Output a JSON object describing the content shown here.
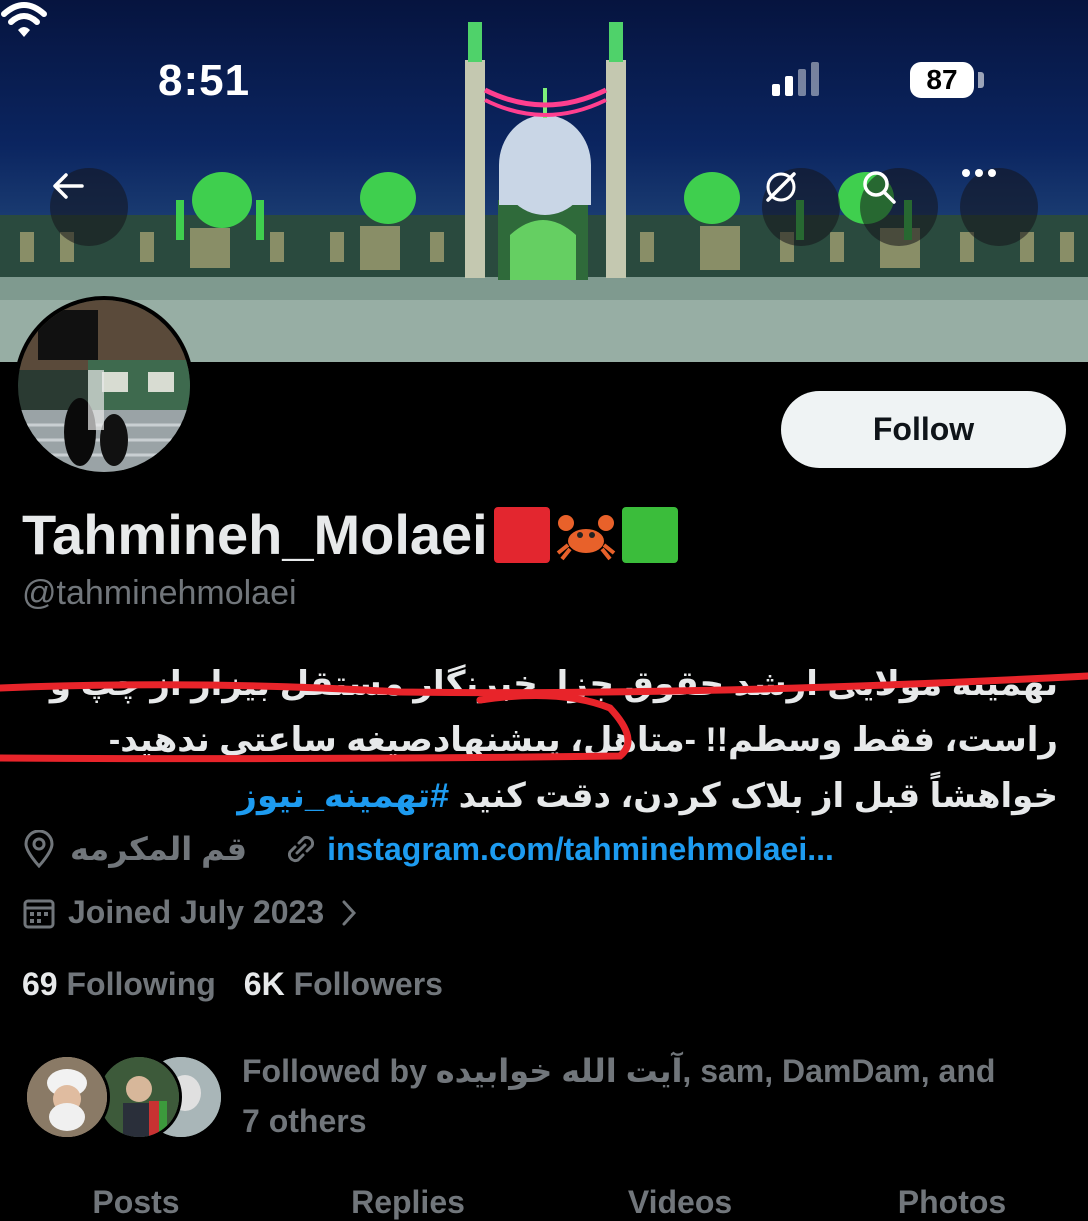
{
  "status_bar": {
    "time": "8:51",
    "battery": "87"
  },
  "profile": {
    "display_name": "Tahmineh_Molaei",
    "name_emojis": [
      "red-square",
      "crab",
      "green-square"
    ],
    "handle": "@tahminehmolaei",
    "follow_label": "Follow",
    "bio_line1": "تهمینه مولایی ارشد حقوق جزا. خبرنگار مستقل بیزار از چپ و",
    "bio_line2": "راست، فقط وسطم!! -متاهل، پیشنهادصیغه ساعتی ندهید-",
    "bio_line3": "خواهشاً قبل از بلاک کردن، دقت کنید",
    "bio_hashtag": "#تهمینه_نیوز",
    "location": "قم المکرمه",
    "website": "instagram.com/tahminehmolaei...",
    "joined": "Joined July 2023",
    "following_count": "69",
    "following_label": "Following",
    "followers_count": "6K",
    "followers_label": "Followers",
    "followed_by_line1": "Followed by آیت الله خوابیده, sam, DamDam, and",
    "followed_by_line2": "7 others"
  },
  "tabs": [
    "Posts",
    "Replies",
    "Videos",
    "Photos"
  ],
  "colors": {
    "accent": "#1d9bf0",
    "muted": "#71767b",
    "annotation": "#e8242a"
  }
}
